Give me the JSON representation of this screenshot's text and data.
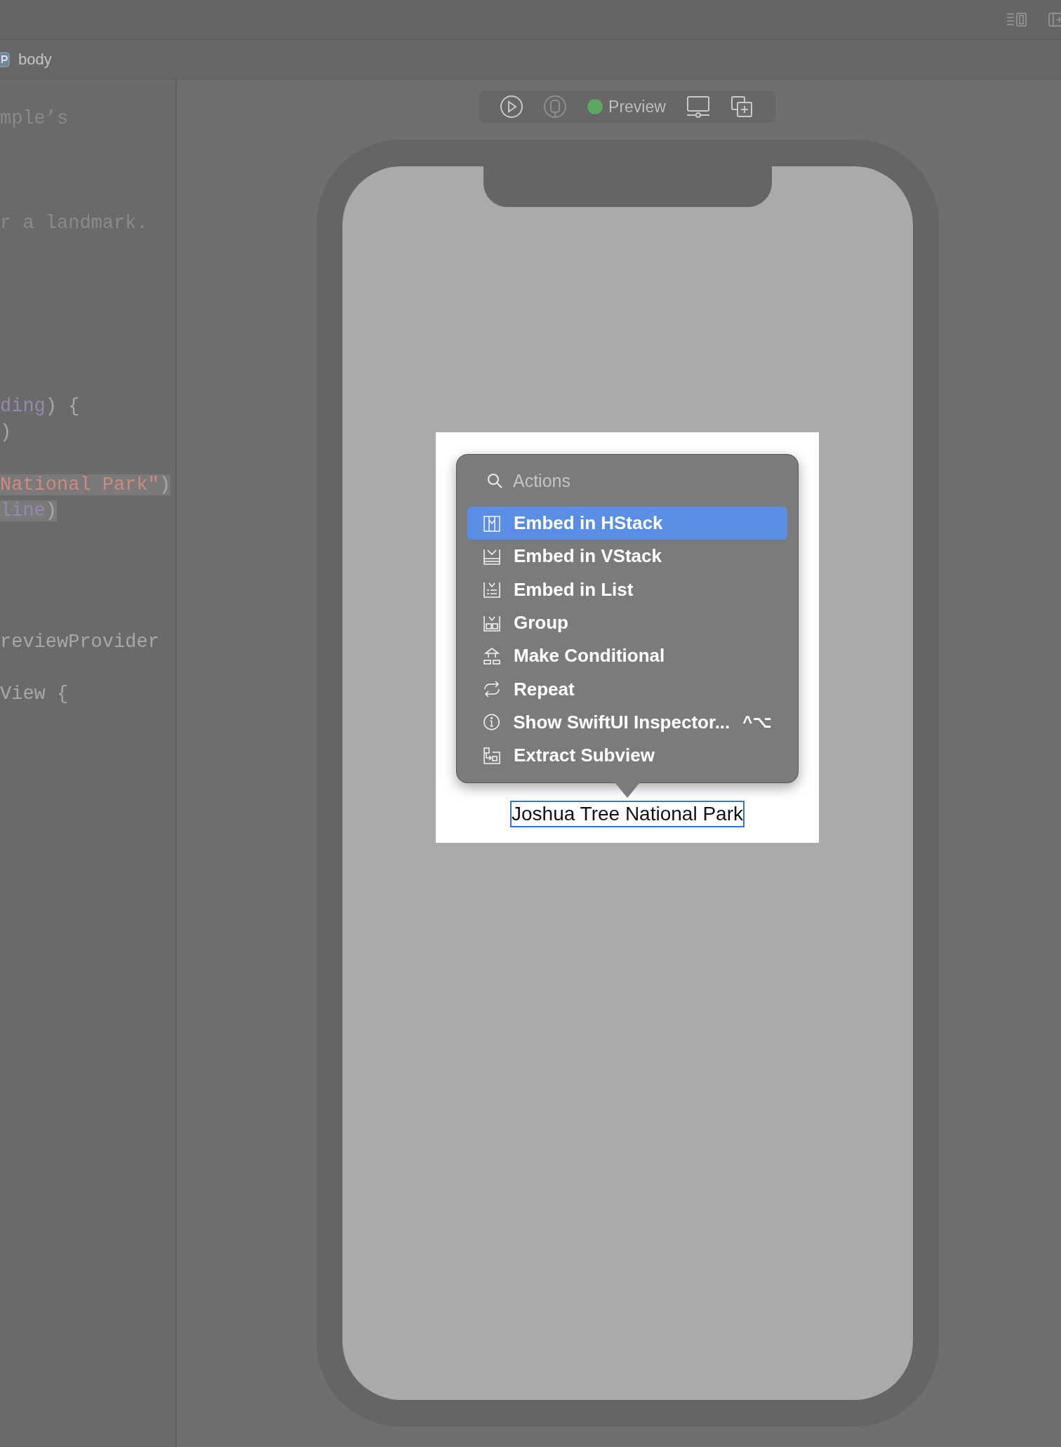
{
  "breadcrumb": {
    "label": "body"
  },
  "code_lines": [
    {
      "tokens": [
        {
          "kind": "comment",
          "text": "mple’s"
        }
      ],
      "highlight": false
    },
    {
      "tokens": [
        {
          "kind": "comment",
          "text": "r a landmark."
        }
      ],
      "highlight": false
    },
    {
      "tokens": [
        {
          "kind": "keyword",
          "text": "ding"
        },
        {
          "kind": "plain",
          "text": ") {"
        }
      ],
      "highlight": false
    },
    {
      "tokens": [
        {
          "kind": "plain",
          "text": ")"
        }
      ],
      "highlight": false
    },
    {
      "tokens": [
        {
          "kind": "string",
          "text": "National Park\""
        },
        {
          "kind": "plain",
          "text": ")"
        }
      ],
      "highlight": true
    },
    {
      "tokens": [
        {
          "kind": "keyword",
          "text": "line"
        },
        {
          "kind": "plain",
          "text": ")"
        }
      ],
      "highlight": true
    },
    {
      "tokens": [
        {
          "kind": "plain",
          "text": "reviewProvider"
        }
      ],
      "highlight": false
    },
    {
      "tokens": [
        {
          "kind": "plain",
          "text": "View {"
        }
      ],
      "highlight": false
    }
  ],
  "preview_toolbar": {
    "label": "Preview"
  },
  "preview": {
    "text": "Joshua Tree National Park"
  },
  "actions_menu": {
    "search_placeholder": "Actions",
    "items": [
      {
        "label": "Embed in HStack",
        "selected": true
      },
      {
        "label": "Embed in VStack",
        "selected": false
      },
      {
        "label": "Embed in List",
        "selected": false
      },
      {
        "label": "Group",
        "selected": false
      },
      {
        "label": "Make Conditional",
        "selected": false
      },
      {
        "label": "Repeat",
        "selected": false
      },
      {
        "label": "Show SwiftUI Inspector...",
        "selected": false,
        "shortcut": "^⌥"
      },
      {
        "label": "Extract Subview",
        "selected": false
      }
    ]
  }
}
